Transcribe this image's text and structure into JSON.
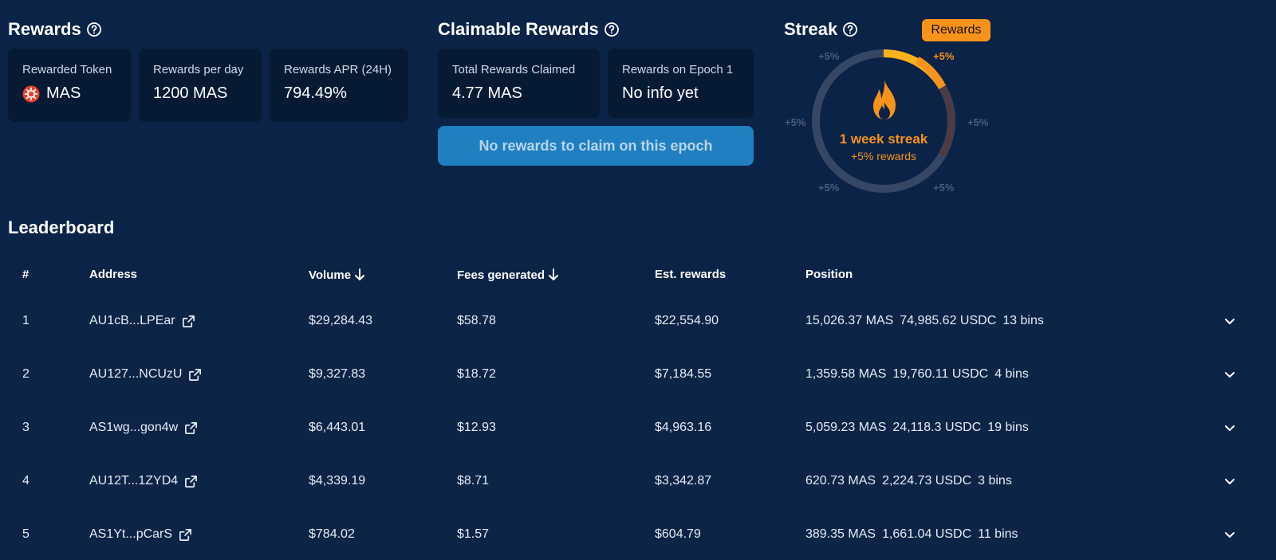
{
  "rewards": {
    "title": "Rewards",
    "cards": [
      {
        "label": "Rewarded Token",
        "value": "MAS",
        "icon": "mas-token-icon"
      },
      {
        "label": "Rewards per day",
        "value": "1200 MAS"
      },
      {
        "label": "Rewards APR (24H)",
        "value": "794.49%"
      }
    ]
  },
  "claimable": {
    "title": "Claimable Rewards",
    "cards": [
      {
        "label": "Total Rewards Claimed",
        "value": "4.77 MAS"
      },
      {
        "label": "Rewards on Epoch 1",
        "value": "No info yet"
      }
    ],
    "claim_button": "No rewards to claim on this epoch"
  },
  "streak": {
    "title": "Streak",
    "badge": "Rewards",
    "center_line1": "1 week streak",
    "center_line2": "+5% rewards",
    "segments": [
      "+5%",
      "+5%",
      "+5%",
      "+5%",
      "+5%",
      "+5%"
    ],
    "active_segments": 1,
    "accent_color": "#f7931a"
  },
  "leaderboard": {
    "title": "Leaderboard",
    "columns": {
      "rank": "#",
      "address": "Address",
      "volume": "Volume",
      "fees": "Fees generated",
      "est_rewards": "Est. rewards",
      "position": "Position"
    },
    "rows": [
      {
        "rank": "1",
        "address": "AU1cB...LPEar",
        "volume": "$29,284.43",
        "fees": "$58.78",
        "est_rewards": "$22,554.90",
        "pos_mas": "15,026.37 MAS",
        "pos_usdc": "74,985.62 USDC",
        "pos_bins": "13 bins"
      },
      {
        "rank": "2",
        "address": "AU127...NCUzU",
        "volume": "$9,327.83",
        "fees": "$18.72",
        "est_rewards": "$7,184.55",
        "pos_mas": "1,359.58 MAS",
        "pos_usdc": "19,760.11 USDC",
        "pos_bins": "4 bins"
      },
      {
        "rank": "3",
        "address": "AS1wg...gon4w",
        "volume": "$6,443.01",
        "fees": "$12.93",
        "est_rewards": "$4,963.16",
        "pos_mas": "5,059.23 MAS",
        "pos_usdc": "24,118.3 USDC",
        "pos_bins": "19 bins"
      },
      {
        "rank": "4",
        "address": "AU12T...1ZYD4",
        "volume": "$4,339.19",
        "fees": "$8.71",
        "est_rewards": "$3,342.87",
        "pos_mas": "620.73 MAS",
        "pos_usdc": "2,224.73 USDC",
        "pos_bins": "3 bins"
      },
      {
        "rank": "5",
        "address": "AS1Yt...pCarS",
        "volume": "$784.02",
        "fees": "$1.57",
        "est_rewards": "$604.79",
        "pos_mas": "389.35 MAS",
        "pos_usdc": "1,661.04 USDC",
        "pos_bins": "11 bins"
      }
    ]
  }
}
